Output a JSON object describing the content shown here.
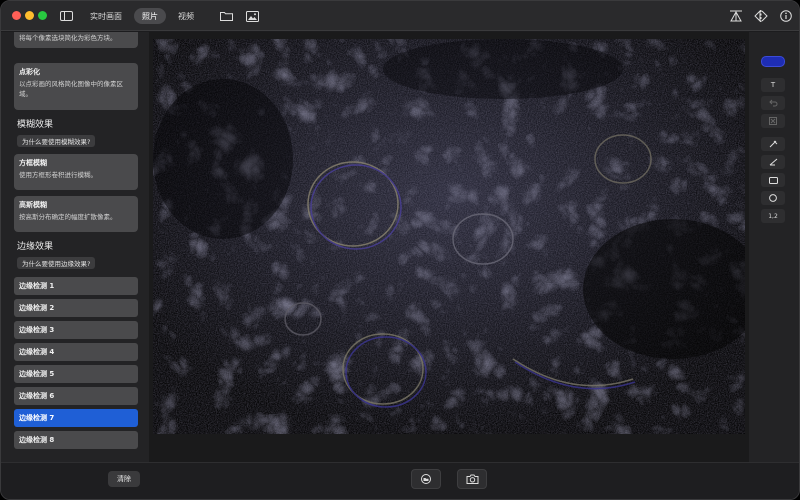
{
  "titlebar": {
    "tabs": [
      {
        "label": "实时画面",
        "active": false
      },
      {
        "label": "照片",
        "active": true
      },
      {
        "label": "视频",
        "active": false
      }
    ]
  },
  "sidebar": {
    "top_card": {
      "desc": "将每个像素选块简化为彩色方块。"
    },
    "pointillize": {
      "title": "点彩化",
      "desc": "以点彩画的风格简化图像中的像素区域。"
    },
    "blur_section": {
      "title": "模糊效果",
      "why_label": "为什么要使用模糊效果?",
      "cards": [
        {
          "title": "方框模糊",
          "desc": "使用方框形卷积进行模糊。"
        },
        {
          "title": "高斯模糊",
          "desc": "按高斯分布确定的幅度扩散像素。"
        }
      ]
    },
    "edge_section": {
      "title": "边缘效果",
      "why_label": "为什么要使用边缘效果?",
      "items": [
        "边缘检测 1",
        "边缘检测 2",
        "边缘检测 3",
        "边缘检测 4",
        "边缘检测 5",
        "边缘检测 6",
        "边缘检测 7",
        "边缘检测 8"
      ],
      "selected_index": 6
    }
  },
  "tools": {
    "color": "#1e2db4",
    "text_tool": "T",
    "number_tool": "1,2"
  },
  "bottom": {
    "clear_label": "清除"
  }
}
